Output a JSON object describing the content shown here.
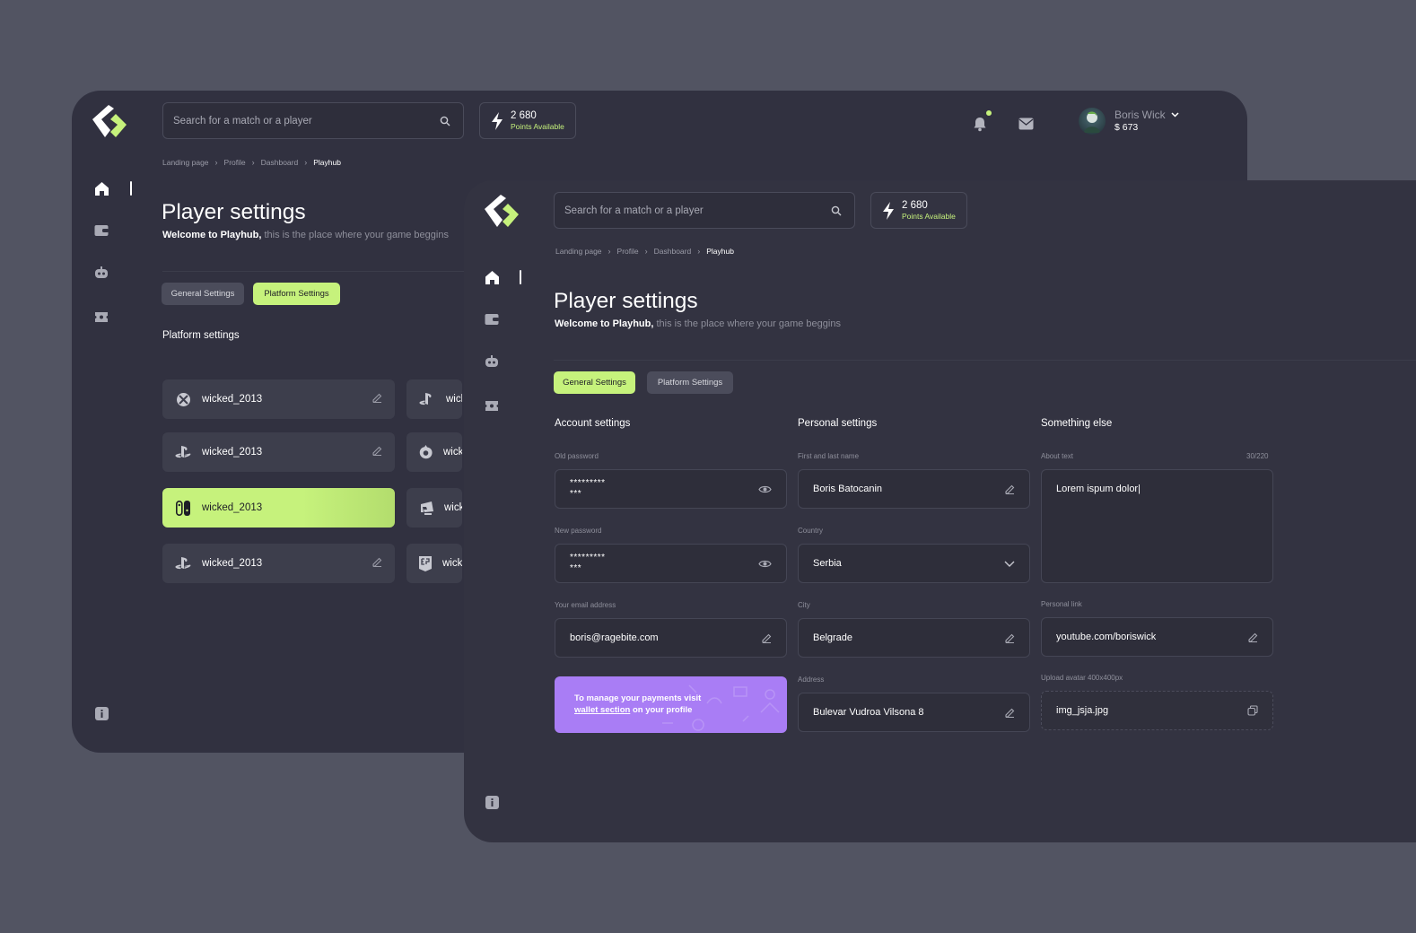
{
  "search_placeholder": "Search for a match or a player",
  "points": {
    "value": "2 680",
    "label": "Points Available"
  },
  "breadcrumb": [
    "Landing page",
    "Profile",
    "Dashboard",
    "Playhub"
  ],
  "title": "Player settings",
  "subtitle_bold": "Welcome to Playhub,",
  "subtitle_rest": " this is the place where your game beggins",
  "tabs": {
    "general": "General Settings",
    "platform": "Platform Settings"
  },
  "user": {
    "name": "Boris Wick",
    "balance": "$ 673"
  },
  "back": {
    "section_title": "Platform settings",
    "platforms": [
      {
        "icon": "xbox-icon",
        "name": "wicked_2013"
      },
      {
        "icon": "playstation-icon",
        "name": "wicked_2013"
      },
      {
        "icon": "nintendo-switch-icon",
        "name": "wicked_2013",
        "active": true
      },
      {
        "icon": "playstation-icon",
        "name": "wicked_2013"
      }
    ],
    "platforms_col2": [
      {
        "icon": "playstation-icon",
        "name": "wick"
      },
      {
        "icon": "origin-icon",
        "name": "wick"
      },
      {
        "icon": "riot-icon",
        "name": "wick"
      },
      {
        "icon": "epic-icon",
        "name": "wick"
      }
    ]
  },
  "front": {
    "account": {
      "title": "Account settings",
      "old_password_label": "Old password",
      "old_password_value": "*********\n***",
      "new_password_label": "New password",
      "new_password_value": "*********\n***",
      "email_label": "Your email address",
      "email_value": "boris@ragebite.com",
      "promo_line1": "To manage your payments visit",
      "promo_link": "wallet section",
      "promo_line2": " on your profile"
    },
    "personal": {
      "title": "Personal settings",
      "name_label": "First and last name",
      "name_value": "Boris Batocanin",
      "country_label": "Country",
      "country_value": "Serbia",
      "city_label": "City",
      "city_value": "Belgrade",
      "address_label": "Address",
      "address_value": "Bulevar Vudroa Vilsona 8"
    },
    "else": {
      "title": "Something else",
      "about_label": "About text",
      "about_count": "30/220",
      "about_value": "Lorem ispum dolor|",
      "link_label": "Personal link",
      "link_value": "youtube.com/boriswick",
      "avatar_label": "Upload avatar 400x400px",
      "avatar_value": "img_jsja.jpg"
    }
  },
  "colors": {
    "accent": "#c6f27c",
    "promo": "#a97df5",
    "panel": "#313140",
    "background": "#525462"
  }
}
